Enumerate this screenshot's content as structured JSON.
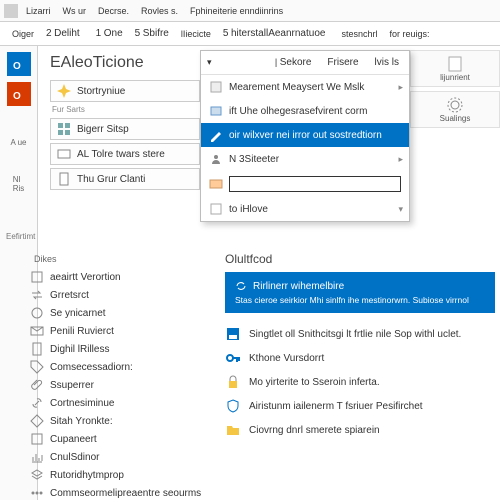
{
  "ribbon": {
    "tabs": [
      "Lizarri",
      "Ws ur",
      "Decrse.",
      "Rovles s.",
      "Fphineiterie enndiinrins"
    ],
    "row2": [
      "Oiger",
      "Deliht",
      "One",
      "Sbifre",
      "lIiecicte",
      "hiterstallAeanrnatuoe",
      "stesnchrl",
      "for reuigs:"
    ],
    "nums": [
      "2",
      "1",
      "5",
      "5"
    ]
  },
  "title": "EAleoTicione",
  "upper": {
    "sub1": "Fur Sarts",
    "items": [
      "Stortryniue",
      "Bigerr Sitsp",
      "AL Tolre twars stere",
      "Thu Grur Clanti"
    ]
  },
  "section_label": "Eefirtimt",
  "lower": {
    "header": "Dikes",
    "items": [
      "aeairtt Verortion",
      "Grretsrct",
      "Se ynicarnet",
      "Penili Ruvierct",
      "Dighil lRilless",
      "Comsecessadiorn:",
      "Ssuperrer",
      "Cortnesiminue",
      "Sitah Yronkte:",
      "Cupaneert",
      "CnulSdinor",
      "Rutoridhytmprop",
      "Commseormelipreaentre seourms"
    ]
  },
  "dropdown": {
    "top": [
      "Sekore",
      "Frisere",
      "lvis ls"
    ],
    "items": [
      "Mearement Meaysert We Mslk",
      "ift Uhe olhegesrasefvirent corm",
      "oir wilxver nei irror out sostredtiorn",
      "N 3Siteeter",
      "",
      "to iHlove"
    ]
  },
  "right": {
    "items": [
      "lijunrient",
      "Sualings"
    ]
  },
  "panel": {
    "title": "Olultfcod",
    "banner_title": "Rirlinerr wihemelbire",
    "banner_sub": "Stas cieroe seirkior Mhi sinlfn ihe mestinorwrn. Subiose virrnol",
    "features": [
      "Singtlet oll Snithcitsgi lt frtlie nile Sop withl uclet.",
      "Kthone Vursdorrt",
      "Mo yirterite to Sseroin inferta.",
      "Airistunm iailenerm T fsriuer Pesifirchet",
      "Ciovrng dnrl smerete spiarein"
    ]
  },
  "colors": {
    "accent": "#0072c6"
  }
}
